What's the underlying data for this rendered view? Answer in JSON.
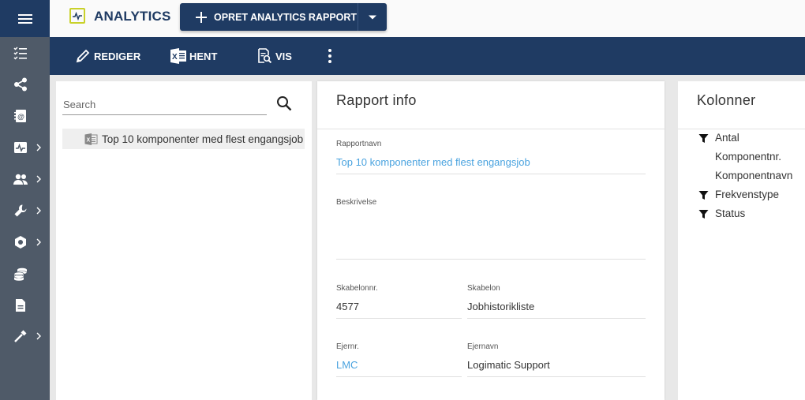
{
  "topbar": {
    "app_title": "ANALYTICS",
    "create_button_label": "OPRET ANALYTICS RAPPORT"
  },
  "toolbar": {
    "edit_label": "REDIGER",
    "fetch_label": "HENT",
    "view_label": "VIS"
  },
  "left": {
    "search_placeholder": "Search",
    "reports": [
      {
        "name": "Top 10 komponenter med flest engangsjob"
      }
    ]
  },
  "info": {
    "title": "Rapport info",
    "report_name_label": "Rapportnavn",
    "report_name_value": "Top 10 komponenter med flest engangsjob",
    "description_label": "Beskrivelse",
    "description_value": "",
    "template_no_label": "Skabelonnr.",
    "template_no_value": "4577",
    "template_label": "Skabelon",
    "template_value": "Jobhistorikliste",
    "owner_no_label": "Ejernr.",
    "owner_no_value": "LMC",
    "owner_name_label": "Ejernavn",
    "owner_name_value": "Logimatic Support"
  },
  "columns": {
    "title": "Kolonner",
    "items": [
      {
        "label": "Antal",
        "filter": true
      },
      {
        "label": "Komponentnr.",
        "filter": false
      },
      {
        "label": "Komponentnavn",
        "filter": false
      },
      {
        "label": "Frekvenstype",
        "filter": true
      },
      {
        "label": "Status",
        "filter": true
      }
    ]
  },
  "colors": {
    "primary": "#1f3b63",
    "rail": "#4f5a68",
    "link": "#4aa3df",
    "logo_accent": "#c9d12a"
  },
  "icons": {
    "rail": [
      "menu-icon",
      "checklist-icon",
      "share-icon",
      "contacts-icon",
      "activity-icon",
      "people-icon",
      "wrench-icon",
      "hexagon-icon",
      "coins-icon",
      "document-icon",
      "hammer-icon"
    ]
  }
}
